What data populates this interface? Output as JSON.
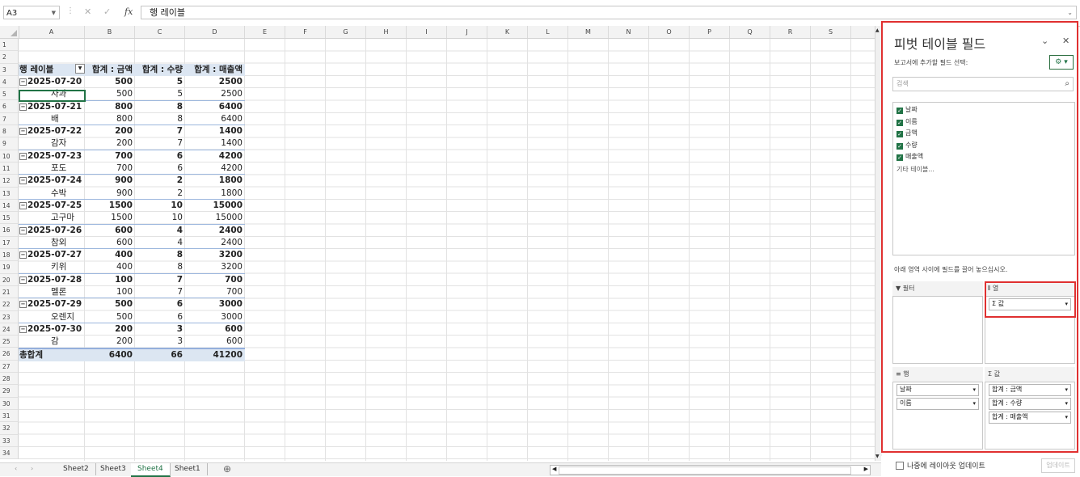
{
  "formula_bar": {
    "name_box": "A3",
    "fx_label": "fx",
    "cancel": "✕",
    "confirm": "✓",
    "content": "행 레이블"
  },
  "columns": [
    "A",
    "B",
    "C",
    "D",
    "E",
    "F",
    "G",
    "H",
    "I",
    "J",
    "K",
    "L",
    "M",
    "N",
    "O",
    "P",
    "Q",
    "R",
    "S"
  ],
  "rows": [
    "1",
    "2",
    "3",
    "4",
    "5",
    "6",
    "7",
    "8",
    "9",
    "10",
    "11",
    "12",
    "13",
    "14",
    "15",
    "16",
    "17",
    "18",
    "19",
    "20",
    "21",
    "22",
    "23",
    "24",
    "25",
    "26",
    "27",
    "28",
    "29",
    "30",
    "31",
    "32",
    "33",
    "34"
  ],
  "pivot": {
    "header": [
      "행 레이블",
      "합계 : 금액",
      "합계 : 수량",
      "합계 : 매출액"
    ],
    "groups": [
      {
        "date": "2025-07-20",
        "amt": "500",
        "qty": "5",
        "sales": "2500",
        "item": "사과",
        "iamt": "500",
        "iqty": "5",
        "isales": "2500"
      },
      {
        "date": "2025-07-21",
        "amt": "800",
        "qty": "8",
        "sales": "6400",
        "item": "배",
        "iamt": "800",
        "iqty": "8",
        "isales": "6400"
      },
      {
        "date": "2025-07-22",
        "amt": "200",
        "qty": "7",
        "sales": "1400",
        "item": "감자",
        "iamt": "200",
        "iqty": "7",
        "isales": "1400"
      },
      {
        "date": "2025-07-23",
        "amt": "700",
        "qty": "6",
        "sales": "4200",
        "item": "포도",
        "iamt": "700",
        "iqty": "6",
        "isales": "4200"
      },
      {
        "date": "2025-07-24",
        "amt": "900",
        "qty": "2",
        "sales": "1800",
        "item": "수박",
        "iamt": "900",
        "iqty": "2",
        "isales": "1800"
      },
      {
        "date": "2025-07-25",
        "amt": "1500",
        "qty": "10",
        "sales": "15000",
        "item": "고구마",
        "iamt": "1500",
        "iqty": "10",
        "isales": "15000"
      },
      {
        "date": "2025-07-26",
        "amt": "600",
        "qty": "4",
        "sales": "2400",
        "item": "참외",
        "iamt": "600",
        "iqty": "4",
        "isales": "2400"
      },
      {
        "date": "2025-07-27",
        "amt": "400",
        "qty": "8",
        "sales": "3200",
        "item": "키위",
        "iamt": "400",
        "iqty": "8",
        "isales": "3200"
      },
      {
        "date": "2025-07-28",
        "amt": "100",
        "qty": "7",
        "sales": "700",
        "item": "멜론",
        "iamt": "100",
        "iqty": "7",
        "isales": "700"
      },
      {
        "date": "2025-07-29",
        "amt": "500",
        "qty": "6",
        "sales": "3000",
        "item": "오렌지",
        "iamt": "500",
        "iqty": "6",
        "isales": "3000"
      },
      {
        "date": "2025-07-30",
        "amt": "200",
        "qty": "3",
        "sales": "600",
        "item": "감",
        "iamt": "200",
        "iqty": "3",
        "isales": "600"
      }
    ],
    "total": {
      "label": "총합계",
      "amt": "6400",
      "qty": "66",
      "sales": "41200"
    }
  },
  "sheet_tabs": [
    "Sheet2",
    "Sheet3",
    "Sheet4",
    "Sheet1"
  ],
  "active_sheet": "Sheet4",
  "pane": {
    "title": "피벗 테이블 필드",
    "subtitle": "보고서에 추가할 필드 선택:",
    "search_placeholder": "검색",
    "fields": [
      "날짜",
      "이름",
      "금액",
      "수량",
      "매출액"
    ],
    "more_tables": "기타 테이블...",
    "drag_note": "아래 영역 사이에 필드를 끌어 놓으십시오.",
    "filter_label": "필터",
    "columns_label": "열",
    "columns_items": [
      "Σ 값"
    ],
    "rows_label": "행",
    "rows_items": [
      "날짜",
      "이름"
    ],
    "values_label": "값",
    "values_items": [
      "합계 : 금액",
      "합계 : 수량",
      "합계 : 매출액"
    ],
    "defer_label": "나중에 레이아웃 업데이트",
    "update_button": "업데이트"
  }
}
